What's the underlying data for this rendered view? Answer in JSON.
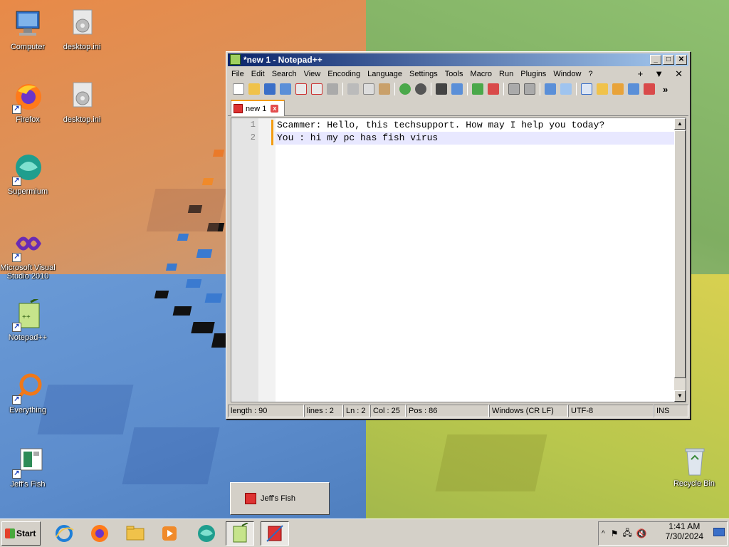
{
  "desktop": {
    "icons": [
      {
        "label": "Computer"
      },
      {
        "label": "desktop.ini"
      },
      {
        "label": "Firefox"
      },
      {
        "label": "desktop.ini"
      },
      {
        "label": "Supermium"
      },
      {
        "label": "Microsoft Visual Studio 2010"
      },
      {
        "label": "Notepad++"
      },
      {
        "label": "Everything"
      },
      {
        "label": "Jeff's Fish"
      },
      {
        "label": "Recycle Bin"
      }
    ]
  },
  "notepad": {
    "title": "*new 1 - Notepad++",
    "window_buttons": {
      "minimize": "_",
      "maximize": "□",
      "close": "✕"
    },
    "menu": [
      "File",
      "Edit",
      "Search",
      "View",
      "Encoding",
      "Language",
      "Settings",
      "Tools",
      "Macro",
      "Run",
      "Plugins",
      "Window",
      "?"
    ],
    "menu_right": {
      "add": "+",
      "dropdown": "▼",
      "close": "✕"
    },
    "toolbar_overflow": "»",
    "tab": {
      "label": "new 1",
      "close": "x"
    },
    "lines": [
      {
        "num": "1",
        "text": "Scammer: Hello, this techsupport. How may I help you today?"
      },
      {
        "num": "2",
        "text": "You : hi my pc has fish virus"
      }
    ],
    "status": {
      "length": "length : 90",
      "lines": "lines : 2",
      "ln": "Ln : 2",
      "col": "Col : 25",
      "pos": "Pos : 86",
      "eol": "Windows (CR LF)",
      "encoding": "UTF-8",
      "mode": "INS"
    }
  },
  "popup": {
    "label": "Jeff's Fish"
  },
  "taskbar": {
    "start_label": "Start",
    "time": "1:41 AM",
    "date": "7/30/2024"
  }
}
